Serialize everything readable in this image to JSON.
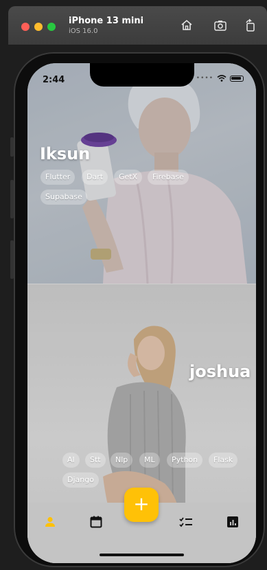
{
  "simulator": {
    "device_name": "iPhone 13 mini",
    "os_version": "iOS 16.0"
  },
  "status_bar": {
    "time": "2:44"
  },
  "profiles": [
    {
      "name": "Iksun",
      "tags": [
        "Flutter",
        "Dart",
        "GetX",
        "Firebase",
        "Supabase"
      ]
    },
    {
      "name": "joshua",
      "tags": [
        "AI",
        "Stt",
        "Nlp",
        "ML",
        "Python",
        "Flask",
        "Django"
      ]
    }
  ],
  "bottom_nav": {
    "fab_label": "+",
    "items": [
      {
        "icon": "person-icon",
        "active": true
      },
      {
        "icon": "calendar-icon",
        "active": false
      },
      {
        "icon": "checklist-icon",
        "active": false
      },
      {
        "icon": "chart-icon",
        "active": false
      }
    ]
  },
  "colors": {
    "accent": "#FFC107",
    "nav_background": "#C4C4C4",
    "tag_background": "rgba(255,255,255,0.28)"
  }
}
